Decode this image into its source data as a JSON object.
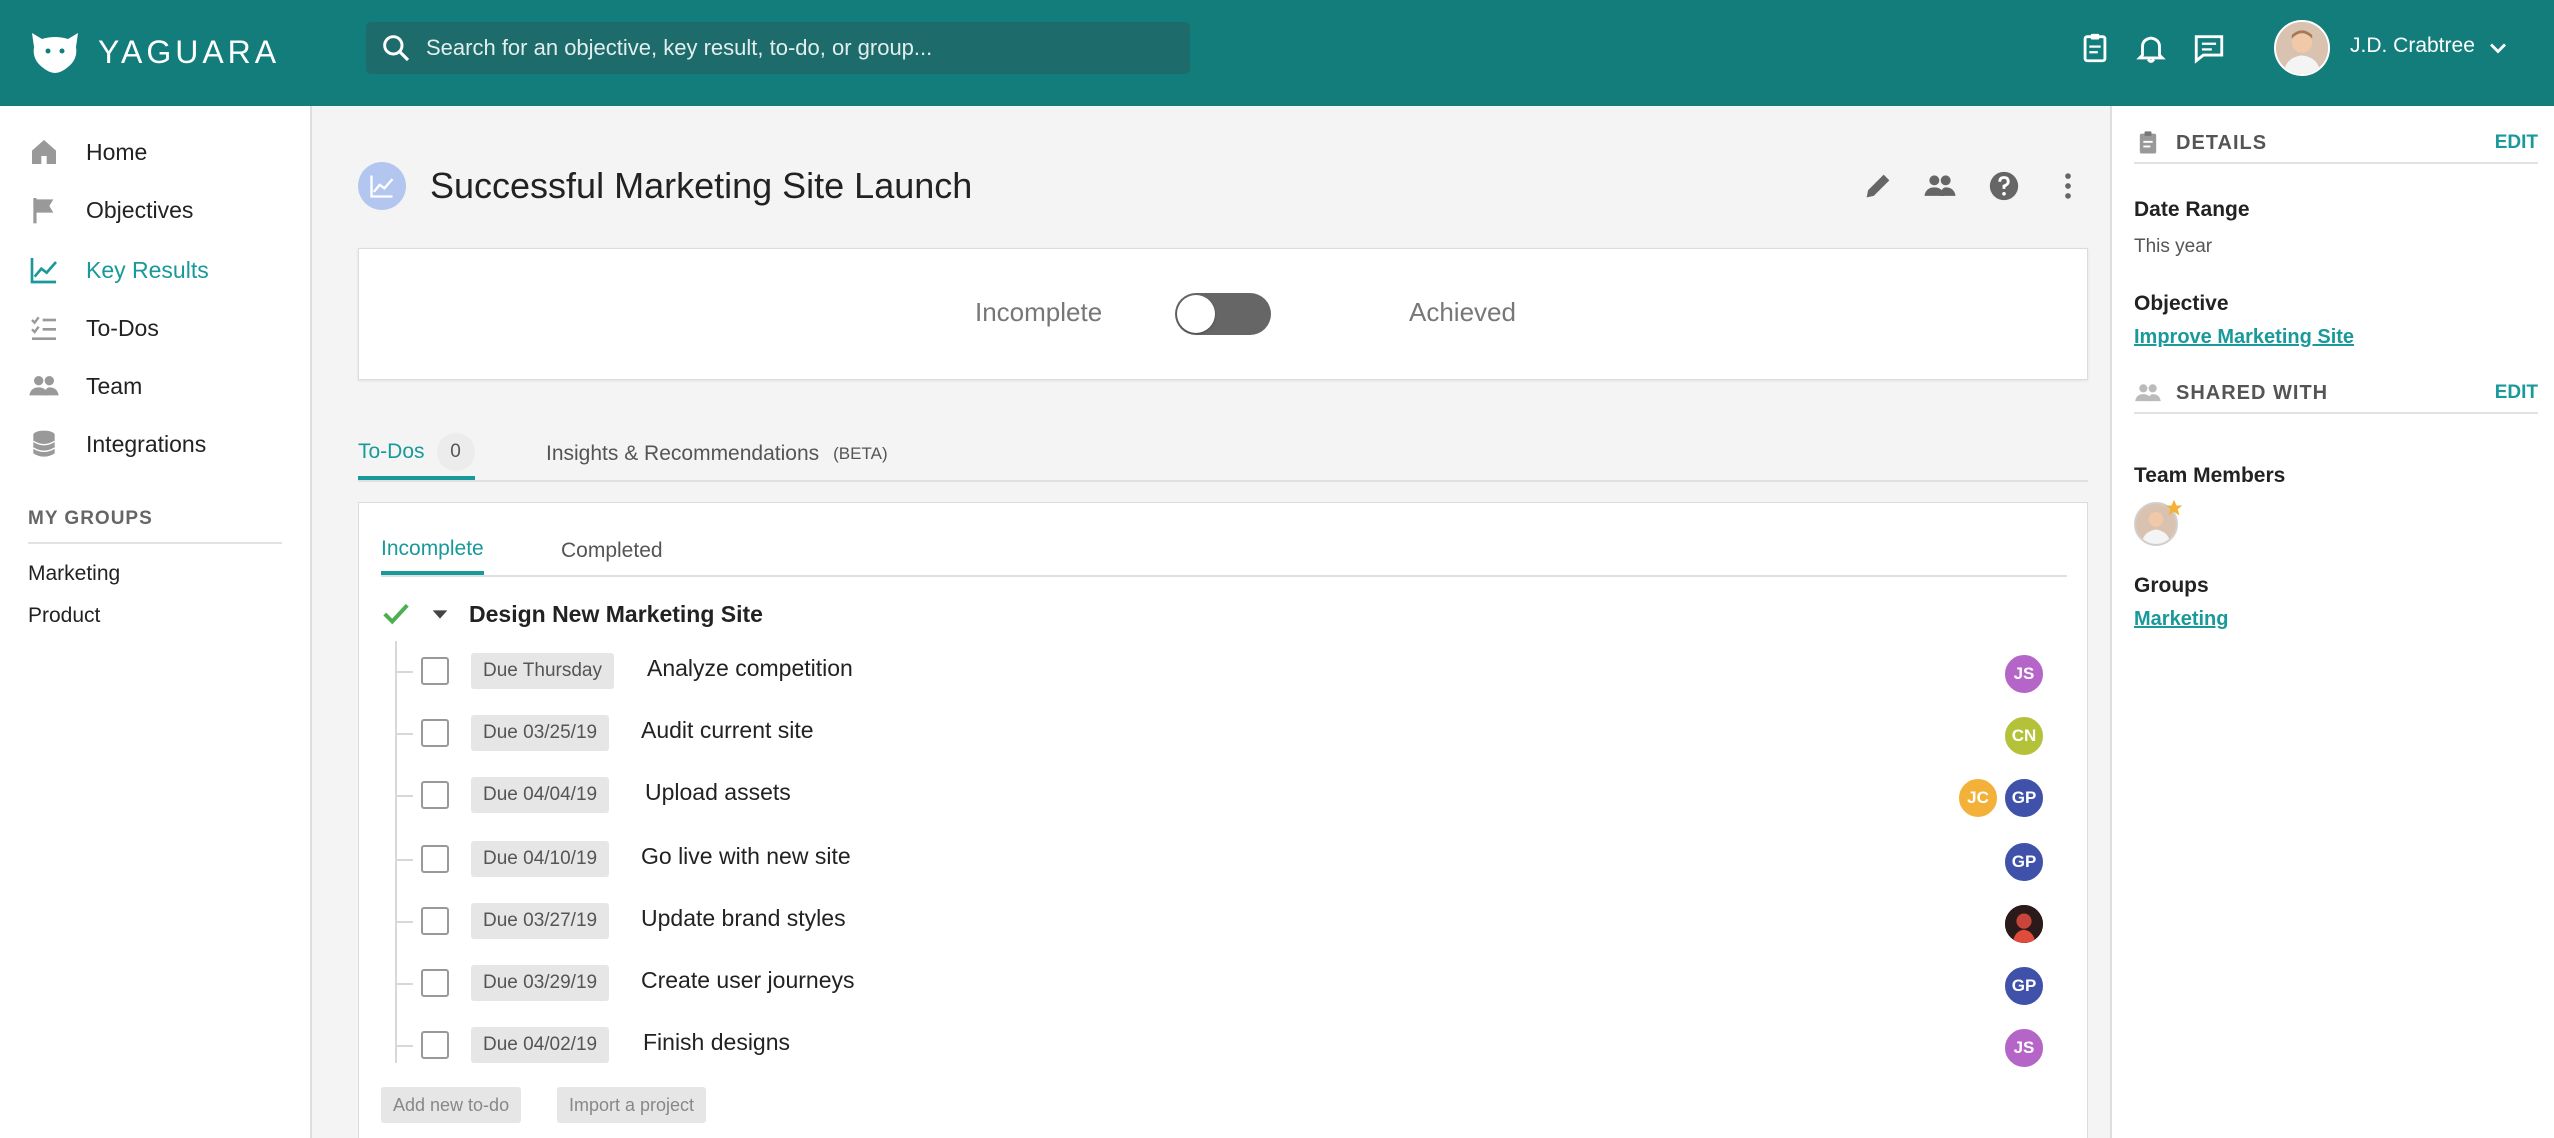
{
  "app": {
    "brand": "YAGUARA"
  },
  "search": {
    "placeholder": "Search for an objective, key result, to-do, or group..."
  },
  "user": {
    "name": "J.D. Crabtree"
  },
  "sidebar": {
    "items": [
      {
        "label": "Home",
        "icon": "home-icon"
      },
      {
        "label": "Objectives",
        "icon": "flag-icon"
      },
      {
        "label": "Key Results",
        "icon": "chart-line-icon",
        "active": true
      },
      {
        "label": "To-Dos",
        "icon": "checklist-icon"
      },
      {
        "label": "Team",
        "icon": "people-icon"
      },
      {
        "label": "Integrations",
        "icon": "database-icon"
      }
    ],
    "groups_title": "MY GROUPS",
    "groups": [
      "Marketing",
      "Product"
    ]
  },
  "main": {
    "title": "Successful Marketing Site Launch",
    "status": {
      "left_label": "Incomplete",
      "right_label": "Achieved",
      "achieved": false
    },
    "tabs": [
      {
        "label": "To-Dos",
        "count": "0"
      },
      {
        "label": "Insights & Recommendations",
        "badge": "(BETA)"
      }
    ],
    "subtabs": [
      "Incomplete",
      "Completed"
    ],
    "group_name": "Design New Marketing Site",
    "todos": [
      {
        "due": "Due Thursday",
        "title": "Analyze competition",
        "assignees": [
          "JS"
        ]
      },
      {
        "due": "Due 03/25/19",
        "title": "Audit current site",
        "assignees": [
          "CN"
        ]
      },
      {
        "due": "Due 04/04/19",
        "title": "Upload assets",
        "assignees": [
          "JC",
          "GP"
        ]
      },
      {
        "due": "Due 04/10/19",
        "title": "Go live with new site",
        "assignees": [
          "GP"
        ]
      },
      {
        "due": "Due 03/27/19",
        "title": "Update brand styles",
        "assignees": [
          "photo"
        ]
      },
      {
        "due": "Due 03/29/19",
        "title": "Create user journeys",
        "assignees": [
          "GP"
        ]
      },
      {
        "due": "Due 04/02/19",
        "title": "Finish designs",
        "assignees": [
          "JS"
        ]
      }
    ],
    "buttons": {
      "add_todo": "Add new to-do",
      "import_project": "Import a project"
    }
  },
  "details": {
    "header": "DETAILS",
    "edit": "EDIT",
    "date_range_label": "Date Range",
    "date_range_value": "This year",
    "objective_label": "Objective",
    "objective_value": "Improve Marketing Site"
  },
  "shared": {
    "header": "SHARED WITH",
    "edit": "EDIT",
    "team_label": "Team Members",
    "groups_label": "Groups",
    "group_value": "Marketing"
  },
  "colors": {
    "brand": "#137d7c",
    "accent": "#19999a",
    "avatar_JS": "#b565c8",
    "avatar_CN": "#b4c23a",
    "avatar_JC": "#f4b13a",
    "avatar_GP": "#3f51a8"
  }
}
